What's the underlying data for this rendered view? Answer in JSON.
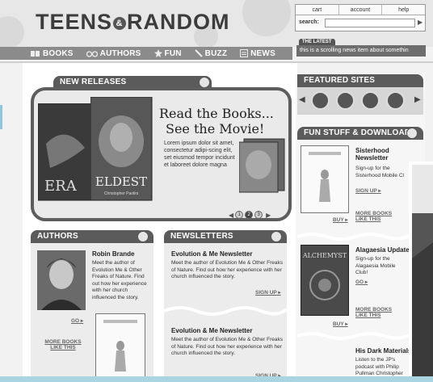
{
  "header": {
    "logo": {
      "left": "TEENS",
      "amp": "&",
      "right": "RANDOM"
    },
    "util_links": [
      "cart",
      "account",
      "help"
    ],
    "search_label": "search:",
    "search_value": "",
    "search_go": "▶"
  },
  "nav": {
    "items": [
      "BOOKS",
      "AUTHORS",
      "FUN",
      "BUZZ",
      "NEWS"
    ]
  },
  "latest": {
    "label": "THE LATEST",
    "text": "this is a scrolling news item about somethin"
  },
  "new_releases": {
    "heading": "NEW RELEASES",
    "title_line1": "Read the Books...",
    "title_line2": "See the Movie!",
    "blurb": "Lorem ipsum dolor sit amet, consectetur adipi-scing elit, set eiusmod tempor incidunt et laboreet dolore magna",
    "book1_title": "ERA",
    "book2_title": "ELDEST",
    "book2_author": "Christopher Paolini",
    "carousel": [
      "1",
      "2",
      "3"
    ]
  },
  "authors": {
    "heading": "AUTHORS",
    "name": "Robin Brande",
    "text": "Meet the author of Evolution Me & Other Freaks of Nature. Find out how her experience with her church influenced the story.",
    "go": "GO",
    "more": "MORE BOOKS LIKE THIS"
  },
  "newsletters": {
    "heading": "NEWSLETTERS",
    "items": [
      {
        "title": "Evolution & Me Newsletter",
        "text": "Meet the author of Evolution Me & Other Freaks of Nature. Find out how her experience with her church influenced the story.",
        "signup": "SIGN UP"
      },
      {
        "title": "Evolution & Me Newsletter",
        "text": "Meet the author of Evolution Me & Other Freaks of Nature. Find out how her experience with her church influenced the story.",
        "signup": "SIGN UP"
      }
    ]
  },
  "featured": {
    "heading": "FEATURED SITES",
    "buttons": [
      "prev",
      "jeans",
      "bird",
      "dragon",
      "gymnast",
      "next"
    ]
  },
  "fun_stuff": {
    "heading": "FUN STUFF & DOWNLOADS",
    "items": [
      {
        "title": "Sisterhood Newsletter",
        "text": "Sign-up for the Sisterhood Mobile Cl",
        "action": "SIGN UP",
        "buy": "BUY",
        "more": "MORE BOOKS LIKE THIS"
      },
      {
        "title": "Alagaesia Updates",
        "text": "Sign-up for the Alagaesia Mobile Club!",
        "action": "GO",
        "buy": "BUY",
        "more": "MORE BOOKS LIKE THIS",
        "book_title": "ALCHEMYST"
      },
      {
        "title": "His Dark Materials",
        "text": "Listen to the JP's podcast with Philip Pullman Christopher"
      }
    ]
  },
  "colors": {
    "accent": "#5b5b5b",
    "bottom_bar": "#a9d4e2"
  }
}
